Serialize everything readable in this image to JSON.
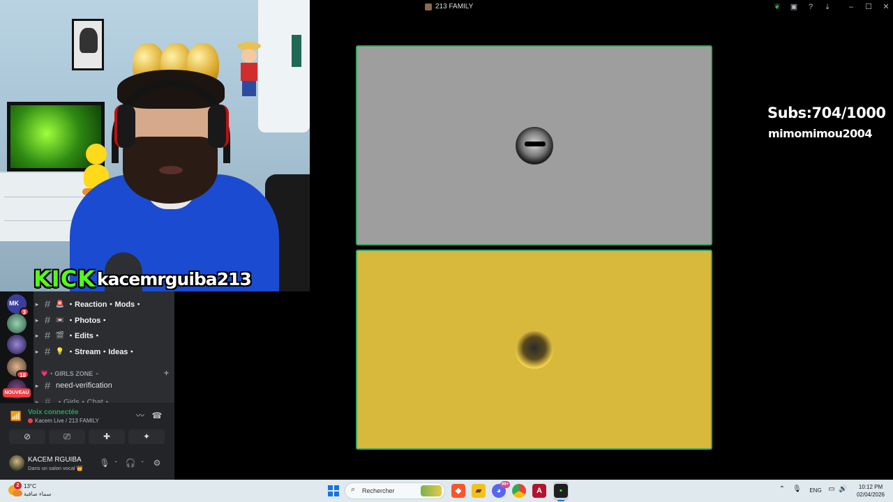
{
  "stream": {
    "kick_logo": "KICK",
    "username": "kacemrguiba213",
    "overlay_subs": "Subs:704/1000",
    "overlay_user": "mimomimou2004"
  },
  "window": {
    "title": "213 FAMILY"
  },
  "servers": [
    {
      "label": "MK",
      "badge": "3"
    },
    {
      "label": "",
      "badge": ""
    },
    {
      "label": "",
      "badge": ""
    },
    {
      "label": "",
      "badge": "18"
    },
    {
      "label": "",
      "badge": ""
    }
  ],
  "new_badge": "NOUVEAU",
  "channels": [
    {
      "emoji": "🚨",
      "name": "・Reaction・Mods・"
    },
    {
      "emoji": "📼",
      "name": "・Photos・"
    },
    {
      "emoji": "🎬",
      "name": "・Edits・"
    },
    {
      "emoji": "💡",
      "name": "・Stream・Ideas・"
    }
  ],
  "category": {
    "label": "・GIRLS ZONE",
    "icon": "💗"
  },
  "channels_bottom": [
    {
      "name": "need-verification"
    },
    {
      "name": "・Girls・Chat・"
    }
  ],
  "voice": {
    "title": "Voix connectée",
    "subtitle": "Kacem Live / 213 FAMILY"
  },
  "user": {
    "name": "KACEM RGUIBA",
    "status": "Dans un salon vocal 👑"
  },
  "taskbar": {
    "temperature": "13°C",
    "condition": "سماء صافية",
    "weather_badge": "2",
    "search_placeholder": "Rechercher",
    "discord_badge": "99+",
    "language": "ENG",
    "time": "10:12 PM",
    "date": "02/04/2026"
  },
  "colors": {
    "kick_green": "#53fc18",
    "speaking_outline": "#3ba55d",
    "tile_1_bg": "#9e9e9e",
    "tile_2_bg": "#d8b93c",
    "voice_green": "#23a559"
  }
}
